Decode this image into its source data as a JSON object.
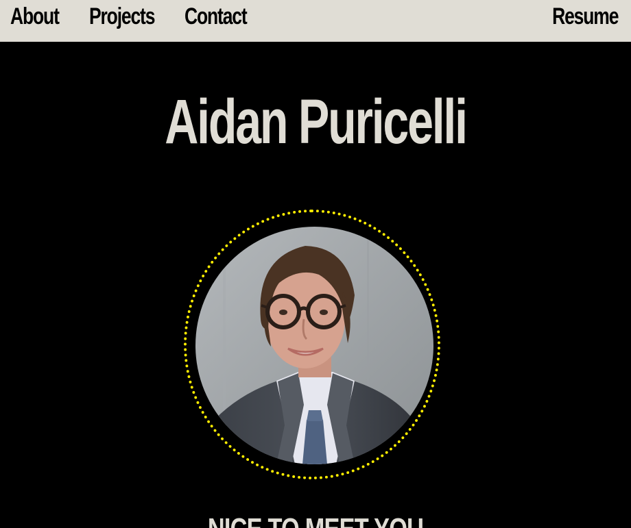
{
  "nav": {
    "about": "About",
    "projects": "Projects",
    "contact": "Contact",
    "resume": "Resume"
  },
  "hero": {
    "name": "Aidan Puricelli"
  },
  "section": {
    "heading": "NICE TO MEET YOU"
  },
  "colors": {
    "nav_background": "#e0ddd5",
    "page_background": "#000000",
    "heading_text": "#e0ddd5",
    "ring_accent": "#ffee00"
  }
}
